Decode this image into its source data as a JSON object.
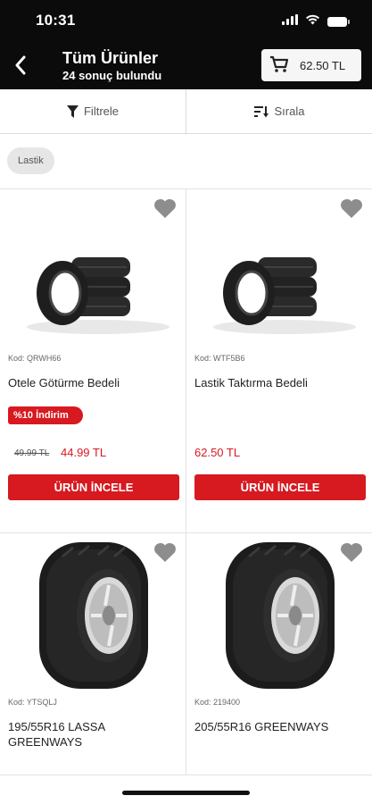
{
  "status_bar": {
    "time": "10:31"
  },
  "header": {
    "title": "Tüm Ürünler",
    "subtitle": "24 sonuç bulundu",
    "cart_total": "62.50 TL"
  },
  "toolbar": {
    "filter_label": "Filtrele",
    "sort_label": "Sırala"
  },
  "chips": [
    {
      "label": "Lastik"
    }
  ],
  "products": [
    {
      "code": "Kod: QRWH66",
      "name": "Otele Götürme Bedeli",
      "discount": "%10 İndirim",
      "old_price": "49.99 TL",
      "price": "44.99 TL",
      "button": "ÜRÜN İNCELE",
      "image": "tire-stack"
    },
    {
      "code": "Kod: WTF5B6",
      "name": "Lastik Taktırma Bedeli",
      "price": "62.50 TL",
      "button": "ÜRÜN İNCELE",
      "image": "tire-stack"
    },
    {
      "code": "Kod: YTSQLJ",
      "name": "195/55R16 LASSA GREENWAYS",
      "image": "tire-front"
    },
    {
      "code": "Kod: 219400",
      "name": "205/55R16 GREENWAYS",
      "image": "tire-front"
    }
  ],
  "colors": {
    "accent": "#d71920",
    "header_bg": "#0b0b0b"
  }
}
